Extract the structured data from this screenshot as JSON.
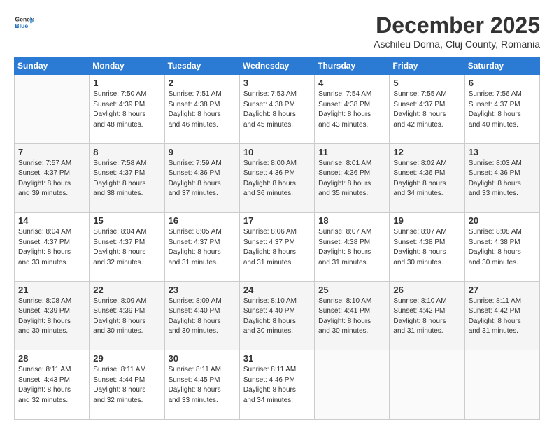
{
  "logo": {
    "line1": "General",
    "line2": "Blue"
  },
  "title": "December 2025",
  "subtitle": "Aschileu Dorna, Cluj County, Romania",
  "weekdays": [
    "Sunday",
    "Monday",
    "Tuesday",
    "Wednesday",
    "Thursday",
    "Friday",
    "Saturday"
  ],
  "weeks": [
    [
      {
        "day": "",
        "info": ""
      },
      {
        "day": "1",
        "info": "Sunrise: 7:50 AM\nSunset: 4:39 PM\nDaylight: 8 hours\nand 48 minutes."
      },
      {
        "day": "2",
        "info": "Sunrise: 7:51 AM\nSunset: 4:38 PM\nDaylight: 8 hours\nand 46 minutes."
      },
      {
        "day": "3",
        "info": "Sunrise: 7:53 AM\nSunset: 4:38 PM\nDaylight: 8 hours\nand 45 minutes."
      },
      {
        "day": "4",
        "info": "Sunrise: 7:54 AM\nSunset: 4:38 PM\nDaylight: 8 hours\nand 43 minutes."
      },
      {
        "day": "5",
        "info": "Sunrise: 7:55 AM\nSunset: 4:37 PM\nDaylight: 8 hours\nand 42 minutes."
      },
      {
        "day": "6",
        "info": "Sunrise: 7:56 AM\nSunset: 4:37 PM\nDaylight: 8 hours\nand 40 minutes."
      }
    ],
    [
      {
        "day": "7",
        "info": "Sunrise: 7:57 AM\nSunset: 4:37 PM\nDaylight: 8 hours\nand 39 minutes."
      },
      {
        "day": "8",
        "info": "Sunrise: 7:58 AM\nSunset: 4:37 PM\nDaylight: 8 hours\nand 38 minutes."
      },
      {
        "day": "9",
        "info": "Sunrise: 7:59 AM\nSunset: 4:36 PM\nDaylight: 8 hours\nand 37 minutes."
      },
      {
        "day": "10",
        "info": "Sunrise: 8:00 AM\nSunset: 4:36 PM\nDaylight: 8 hours\nand 36 minutes."
      },
      {
        "day": "11",
        "info": "Sunrise: 8:01 AM\nSunset: 4:36 PM\nDaylight: 8 hours\nand 35 minutes."
      },
      {
        "day": "12",
        "info": "Sunrise: 8:02 AM\nSunset: 4:36 PM\nDaylight: 8 hours\nand 34 minutes."
      },
      {
        "day": "13",
        "info": "Sunrise: 8:03 AM\nSunset: 4:36 PM\nDaylight: 8 hours\nand 33 minutes."
      }
    ],
    [
      {
        "day": "14",
        "info": "Sunrise: 8:04 AM\nSunset: 4:37 PM\nDaylight: 8 hours\nand 33 minutes."
      },
      {
        "day": "15",
        "info": "Sunrise: 8:04 AM\nSunset: 4:37 PM\nDaylight: 8 hours\nand 32 minutes."
      },
      {
        "day": "16",
        "info": "Sunrise: 8:05 AM\nSunset: 4:37 PM\nDaylight: 8 hours\nand 31 minutes."
      },
      {
        "day": "17",
        "info": "Sunrise: 8:06 AM\nSunset: 4:37 PM\nDaylight: 8 hours\nand 31 minutes."
      },
      {
        "day": "18",
        "info": "Sunrise: 8:07 AM\nSunset: 4:38 PM\nDaylight: 8 hours\nand 31 minutes."
      },
      {
        "day": "19",
        "info": "Sunrise: 8:07 AM\nSunset: 4:38 PM\nDaylight: 8 hours\nand 30 minutes."
      },
      {
        "day": "20",
        "info": "Sunrise: 8:08 AM\nSunset: 4:38 PM\nDaylight: 8 hours\nand 30 minutes."
      }
    ],
    [
      {
        "day": "21",
        "info": "Sunrise: 8:08 AM\nSunset: 4:39 PM\nDaylight: 8 hours\nand 30 minutes."
      },
      {
        "day": "22",
        "info": "Sunrise: 8:09 AM\nSunset: 4:39 PM\nDaylight: 8 hours\nand 30 minutes."
      },
      {
        "day": "23",
        "info": "Sunrise: 8:09 AM\nSunset: 4:40 PM\nDaylight: 8 hours\nand 30 minutes."
      },
      {
        "day": "24",
        "info": "Sunrise: 8:10 AM\nSunset: 4:40 PM\nDaylight: 8 hours\nand 30 minutes."
      },
      {
        "day": "25",
        "info": "Sunrise: 8:10 AM\nSunset: 4:41 PM\nDaylight: 8 hours\nand 30 minutes."
      },
      {
        "day": "26",
        "info": "Sunrise: 8:10 AM\nSunset: 4:42 PM\nDaylight: 8 hours\nand 31 minutes."
      },
      {
        "day": "27",
        "info": "Sunrise: 8:11 AM\nSunset: 4:42 PM\nDaylight: 8 hours\nand 31 minutes."
      }
    ],
    [
      {
        "day": "28",
        "info": "Sunrise: 8:11 AM\nSunset: 4:43 PM\nDaylight: 8 hours\nand 32 minutes."
      },
      {
        "day": "29",
        "info": "Sunrise: 8:11 AM\nSunset: 4:44 PM\nDaylight: 8 hours\nand 32 minutes."
      },
      {
        "day": "30",
        "info": "Sunrise: 8:11 AM\nSunset: 4:45 PM\nDaylight: 8 hours\nand 33 minutes."
      },
      {
        "day": "31",
        "info": "Sunrise: 8:11 AM\nSunset: 4:46 PM\nDaylight: 8 hours\nand 34 minutes."
      },
      {
        "day": "",
        "info": ""
      },
      {
        "day": "",
        "info": ""
      },
      {
        "day": "",
        "info": ""
      }
    ]
  ]
}
